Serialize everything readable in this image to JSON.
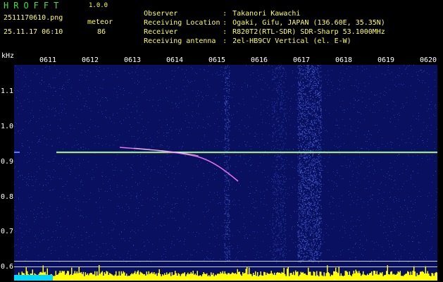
{
  "header": {
    "app_name": "HROFFT",
    "app_version": "1.0.0",
    "file_name": "2511170610.png",
    "meteor_label": "meteor",
    "datetime": "25.11.17 06:10",
    "meteor_count": "86",
    "info": [
      {
        "key": "Observer",
        "value": "Takanori Kawachi"
      },
      {
        "key": "Receiving Location",
        "value": "Ogaki, Gifu, JAPAN (136.60E, 35.35N)"
      },
      {
        "key": "Receiver",
        "value": "R820T2(RTL-SDR) SDR-Sharp 53.1000MHz"
      },
      {
        "key": "Receiving antenna",
        "value": "2el-HB9CV Vertical (el. E-W)"
      }
    ],
    "separator": ":"
  },
  "axes": {
    "unit": "kHz",
    "y_ticks": [
      "1.1",
      "1.0",
      "0.9",
      "0.8",
      "0.7",
      "0.6"
    ],
    "x_ticks": [
      "0611",
      "0612",
      "0613",
      "0614",
      "0615",
      "0616",
      "0617",
      "0618",
      "0619",
      "0620"
    ]
  },
  "colors": {
    "background": "#000000",
    "plot_background": "#0a1060",
    "carrier_line": "#7cff9a",
    "meteor_trace": "#ff7cff",
    "level_bars": "#ffff00",
    "level_bars_alt": "#00d8ff",
    "text_highlight": "#ffff55",
    "app_name": "#3fe23f"
  }
}
